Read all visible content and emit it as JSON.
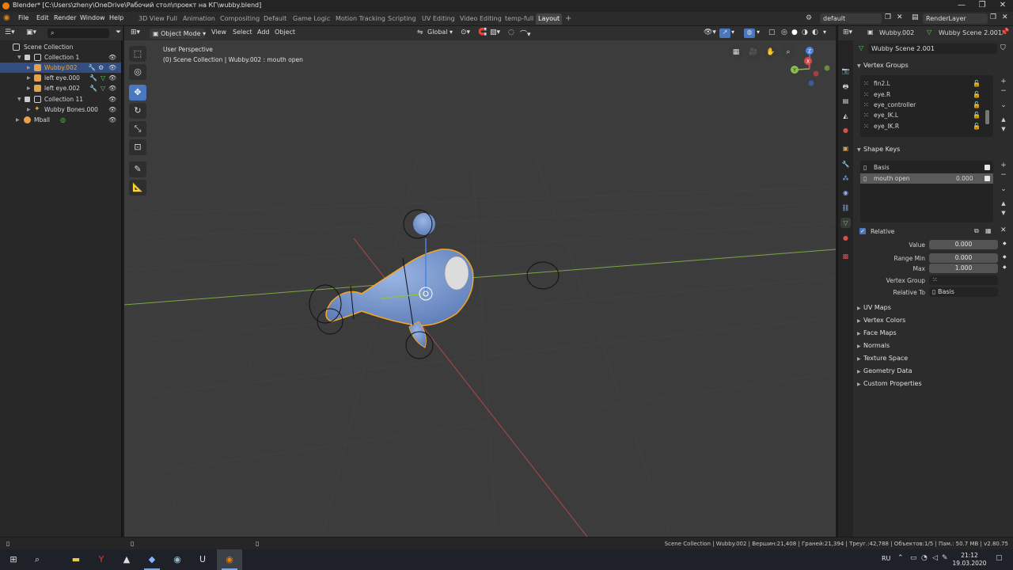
{
  "window": {
    "title": "Blender* [C:\\Users\\zheny\\OneDrive\\Рабочий стол\\проект на КГ\\wubby.blend]",
    "controls": [
      "—",
      "❐",
      "✕"
    ]
  },
  "menu": [
    "File",
    "Edit",
    "Render",
    "Window",
    "Help"
  ],
  "workspaces": {
    "tabs": [
      "3D View Full",
      "Animation",
      "Compositing",
      "Default",
      "Game Logic",
      "Motion Tracking",
      "Scripting",
      "UV Editing",
      "Video Editing",
      "temp-full",
      "Layout"
    ],
    "active": "Layout",
    "add_symbol": "+"
  },
  "scene_selector": {
    "scene": "default",
    "view_layer": "RenderLayer"
  },
  "outliner": {
    "search_placeholder": "",
    "rows": [
      {
        "label": "Scene Collection",
        "indent": 0,
        "kind": "scene"
      },
      {
        "label": "Collection 1",
        "indent": 1,
        "kind": "collection",
        "checked": true
      },
      {
        "label": "Wubby.002",
        "indent": 2,
        "kind": "mesh",
        "selected": true
      },
      {
        "label": "left eye.000",
        "indent": 2,
        "kind": "mesh"
      },
      {
        "label": "left eye.002",
        "indent": 2,
        "kind": "mesh"
      },
      {
        "label": "Collection 11",
        "indent": 1,
        "kind": "collection",
        "checked": true
      },
      {
        "label": "Wubby Bones.000",
        "indent": 2,
        "kind": "armature"
      },
      {
        "label": "Mball",
        "indent": 1,
        "kind": "meta"
      }
    ]
  },
  "viewport": {
    "header": {
      "mode": "Object Mode",
      "menus": [
        "View",
        "Select",
        "Add",
        "Object"
      ],
      "orientation": "Global"
    },
    "overlay_text": {
      "perspective": "User Perspective",
      "context": "(0) Scene Collection | Wubby.002 : mouth open"
    },
    "gizmo_axes": [
      "X",
      "Y",
      "Z"
    ]
  },
  "properties": {
    "header": {
      "object": "Wubby.002",
      "data": "Wubby Scene 2.001"
    },
    "mesh_name": "Wubby Scene 2.001",
    "vertex_groups": {
      "title": "Vertex Groups",
      "items": [
        "fin2.L",
        "eye.R",
        "eye_controller",
        "eye_IK.L",
        "eye_IK.R"
      ]
    },
    "shape_keys": {
      "title": "Shape Keys",
      "items": [
        {
          "name": "Basis",
          "value": "",
          "checked": true
        },
        {
          "name": "mouth open",
          "value": "0.000",
          "checked": true,
          "selected": true
        }
      ],
      "relative_label": "Relative",
      "relative_checked": true
    },
    "shape_key_props": {
      "value_label": "Value",
      "value": "0.000",
      "range_min_label": "Range Min",
      "range_min": "0.000",
      "max_label": "Max",
      "max": "1.000",
      "vertex_group_label": "Vertex Group",
      "vertex_group": "",
      "relative_to_label": "Relative To",
      "relative_to": "Basis"
    },
    "collapsed_panels": [
      "UV Maps",
      "Vertex Colors",
      "Face Maps",
      "Normals",
      "Texture Space",
      "Geometry Data",
      "Custom Properties"
    ]
  },
  "statusbar": {
    "text": "Scene Collection | Wubby.002 | Вершин:21,408 | Граней:21,394 | Треуг.:42,788 | Объектов:1/5 | Пам.: 50.7 MB | v2.80.75"
  },
  "taskbar": {
    "language": "RU",
    "time": "21:12",
    "date": "19.03.2020"
  },
  "colors": {
    "accent": "#4a78c0",
    "selection_outline": "#f5a623",
    "mesh": "#7d9cd0",
    "x_axis": "#d84a4a",
    "y_axis": "#8ac04a",
    "z_axis": "#4a82e6"
  }
}
